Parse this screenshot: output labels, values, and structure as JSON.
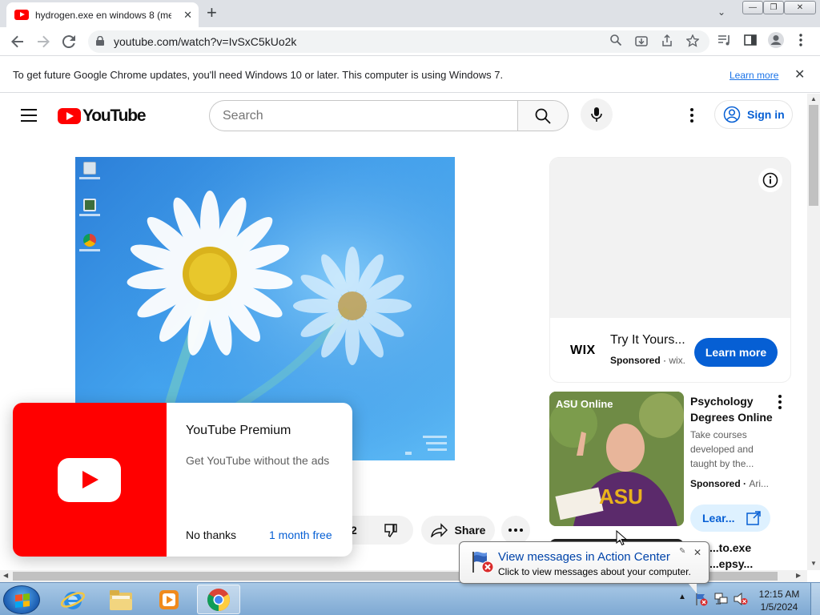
{
  "browser": {
    "tab_title": "hydrogen.exe en windows 8 (meg",
    "tab_close": "✕",
    "new_tab": "+",
    "url": "youtube.com/watch?v=IvSxC5kUo2k",
    "window_min": "—",
    "window_max": "❐",
    "window_close": "✕"
  },
  "infobar": {
    "message": "To get future Google Chrome updates, you'll need Windows 10 or later. This computer is using Windows 7.",
    "learn_more": "Learn more",
    "close": "✕"
  },
  "youtube": {
    "logo_text": "YouTube",
    "search_placeholder": "Search",
    "sign_in": "Sign in",
    "actions": {
      "like_count": "2",
      "share": "Share"
    },
    "ad_wix": {
      "brand": "WIX",
      "title": "Try It Yours...",
      "sponsored": "Sponsored",
      "domain": "wix.",
      "cta": "Learn more"
    },
    "ad_asu": {
      "title": "Psychology Degrees Online",
      "description": "Take courses developed and taught by the...",
      "sponsored": "Sponsored",
      "domain": "Ari...",
      "cta": "Lear...",
      "thumb_brand": "ASU Online"
    },
    "next_item": "...to.exe\n...epsy...",
    "premium": {
      "title": "YouTube Premium",
      "description": "Get YouTube without the ads",
      "decline": "No thanks",
      "trial": "1 month free"
    }
  },
  "taskbar": {
    "time": "12:15 AM",
    "date": "1/5/2024",
    "tray_expand": "▲"
  },
  "balloon": {
    "title": "View messages in Action Center",
    "text": "Click to view messages about your computer.",
    "close": "✕"
  },
  "colors": {
    "youtube_red": "#ff0000",
    "youtube_blue": "#065fd4",
    "chrome_tabstrip": "#dee1e6",
    "taskbar": "#7ea9d3"
  }
}
